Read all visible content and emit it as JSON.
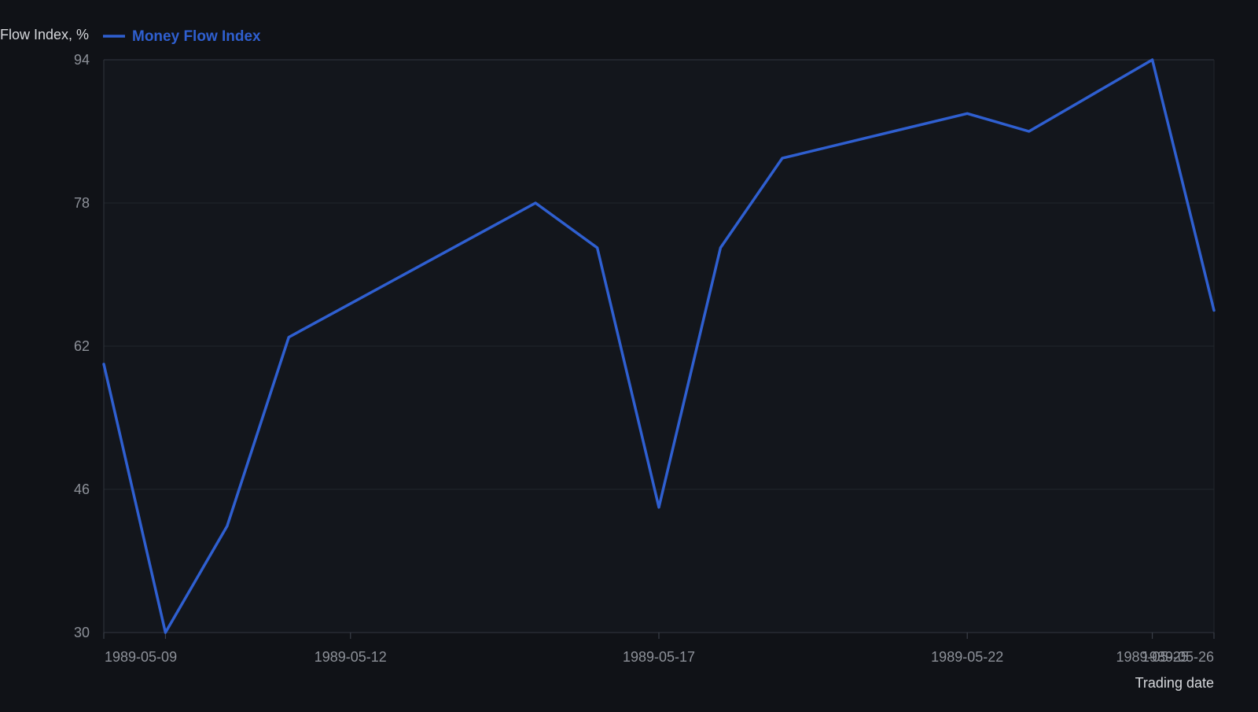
{
  "chart_data": {
    "type": "line",
    "title": "",
    "ylabel": "Money Flow Index, %",
    "xlabel": "Trading date",
    "ylim": [
      30,
      94
    ],
    "y_ticks": [
      30,
      46,
      62,
      78,
      94
    ],
    "x_tick_labels": [
      "1989-05-09",
      "1989-05-12",
      "1989-05-17",
      "1989-05-22",
      "1989-05-25",
      "1989-05-26"
    ],
    "legend": {
      "position": "top-left"
    },
    "grid": true,
    "series": [
      {
        "name": "Money Flow Index",
        "color": "#2f5fd0",
        "points": [
          {
            "x": "1989-05-08",
            "y": 60
          },
          {
            "x": "1989-05-09",
            "y": 30
          },
          {
            "x": "1989-05-10",
            "y": 41.9
          },
          {
            "x": "1989-05-11",
            "y": 63
          },
          {
            "x": "1989-05-15",
            "y": 78
          },
          {
            "x": "1989-05-16",
            "y": 73
          },
          {
            "x": "1989-05-17",
            "y": 44
          },
          {
            "x": "1989-05-18",
            "y": 73
          },
          {
            "x": "1989-05-19",
            "y": 83
          },
          {
            "x": "1989-05-22",
            "y": 88
          },
          {
            "x": "1989-05-23",
            "y": 86
          },
          {
            "x": "1989-05-25",
            "y": 94
          },
          {
            "x": "1989-05-26",
            "y": 66
          }
        ]
      }
    ]
  }
}
